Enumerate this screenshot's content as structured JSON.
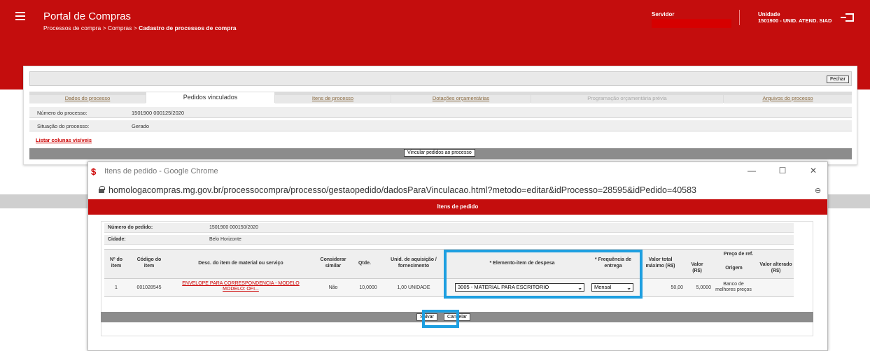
{
  "header": {
    "app_title": "Portal de Compras",
    "breadcrumb_1": "Processos de compra",
    "breadcrumb_sep": " > ",
    "breadcrumb_2": "Compras",
    "breadcrumb_3": "Cadastro de processos de compra",
    "servidor_label": "Servidor",
    "unidade_label": "Unidade",
    "unidade_value": "1501900 - UNID. ATEND. SIAD",
    "colors": {
      "primary": "#c40d0d",
      "highlight": "#1e9fe0"
    }
  },
  "main": {
    "fechar_label": "Fechar",
    "tabs": [
      {
        "label": "Dados do processo"
      },
      {
        "label": "Pedidos vinculados"
      },
      {
        "label": "Itens de processo"
      },
      {
        "label": "Dotações orçamentárias"
      },
      {
        "label": "Programação orçamentária prévia"
      },
      {
        "label": "Arquivos do processo"
      }
    ],
    "numero_label": "Número do processo:",
    "numero_value": "1501900 000125/2020",
    "situacao_label": "Situação do processo:",
    "situacao_value": "Gerado",
    "listar_link": "Listar colunas visíveis",
    "vincular_label": "Vincular pedidos ao processo"
  },
  "popup": {
    "window_title": "Itens de pedido - Google Chrome",
    "url": "homologacompras.mg.gov.br/processocompra/processo/gestaopedido/dadosParaVinculacao.html?metodo=editar&idProcesso=28595&idPedido=40583",
    "header_title": "Itens de pedido",
    "numero_pedido_label": "Número do pedido:",
    "numero_pedido_value": "1501900 000150/2020",
    "cidade_label": "Cidade:",
    "cidade_value": "Belo Horizonte",
    "columns": {
      "item_no": "Nº do item",
      "codigo": "Código do item",
      "descricao": "Desc. do item de material ou serviço",
      "considerar": "Considerar similar",
      "qtde": "Qtde.",
      "unid": "Unid. de aquisição / fornecimento",
      "elemento": "* Elemento-item de despesa",
      "frequencia": "* Frequência de entrega",
      "valor_total": "Valor total máximo (R$)",
      "preco_ref": "Preço de ref.",
      "valor": "Valor (R$)",
      "origem": "Origem",
      "valor_alterado": "Valor alterado (R$)"
    },
    "row": {
      "item_no": "1",
      "codigo": "001028545",
      "descricao": "ENVELOPE PARA CORRESPONDENCIA - MODELO MODELO: OFI...",
      "considerar": "Não",
      "qtde": "10,0000",
      "unid": "1,00 UNIDADE",
      "elemento": "3005 - MATERIAL PARA ESCRITORIO",
      "frequencia": "Mensal",
      "valor_total": "50,00",
      "valor": "5,0000",
      "origem": "Banco de melhores preços"
    },
    "salvar_label": "Salvar",
    "cancelar_label": "Cancelar"
  }
}
